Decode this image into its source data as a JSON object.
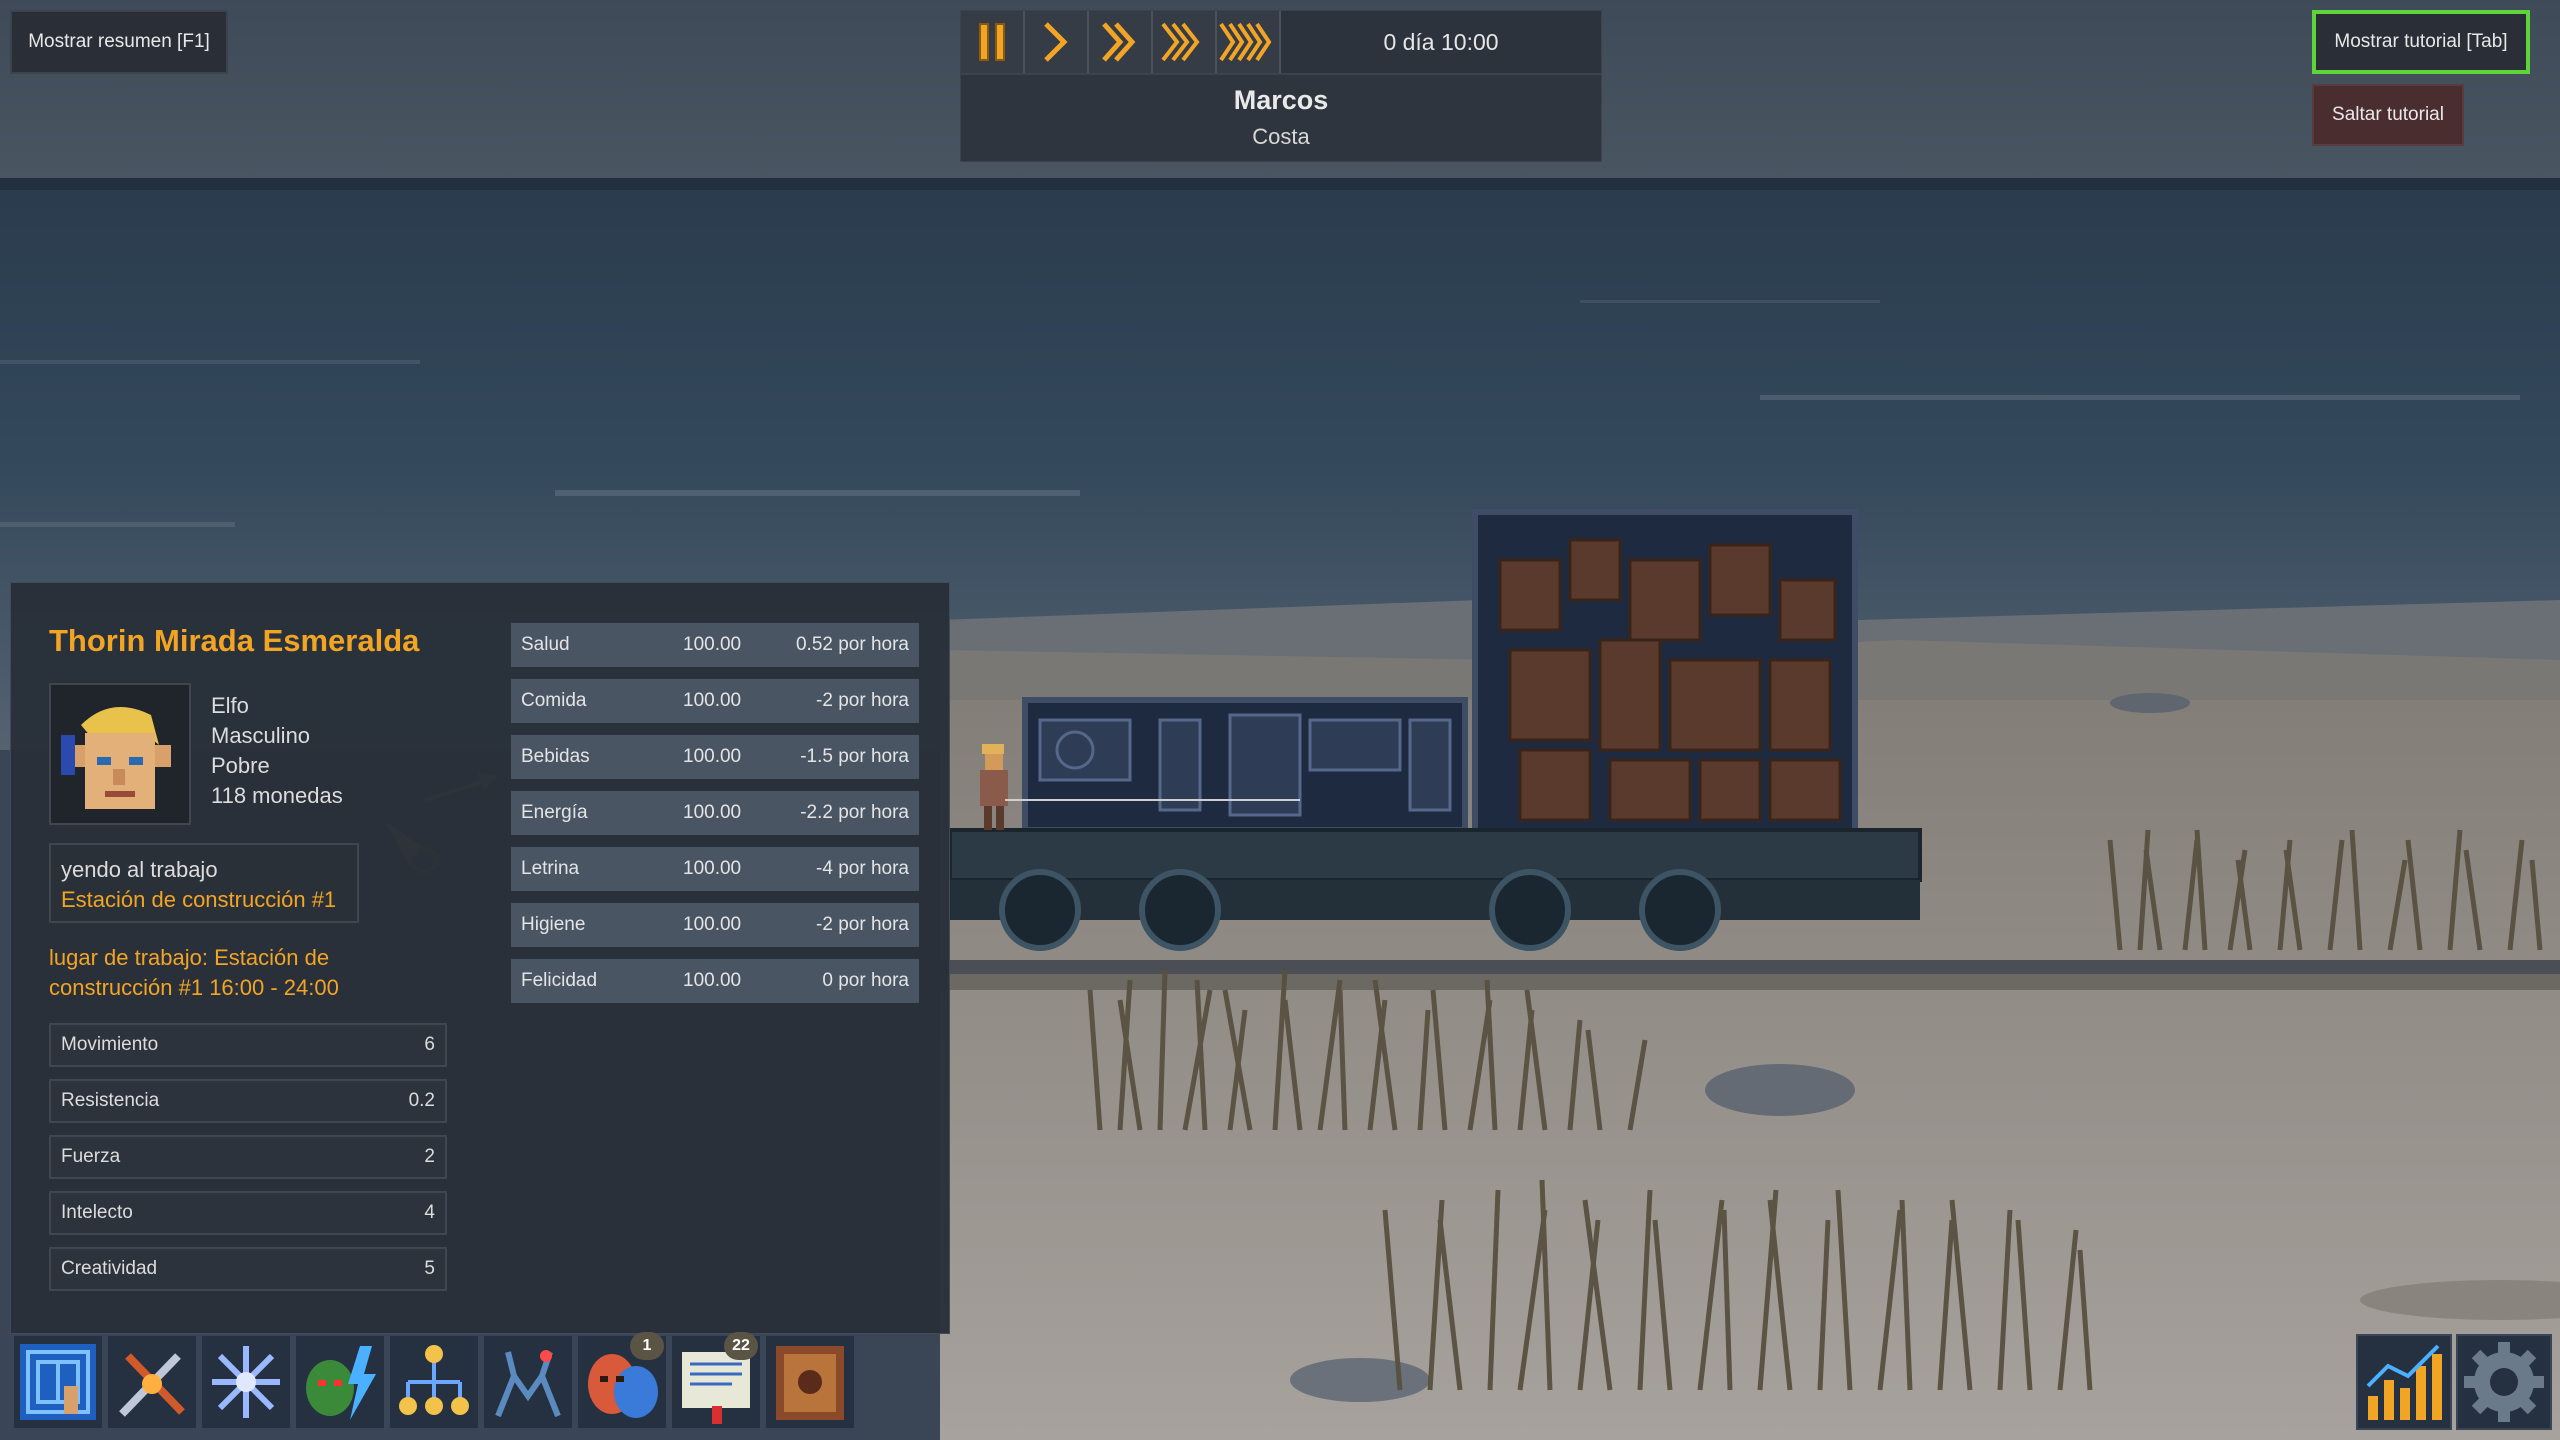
{
  "top_left": {
    "summary_button": "Mostrar resumen [F1]"
  },
  "top_right": {
    "tutorial_button": "Mostrar tutorial [Tab]",
    "skip_button": "Saltar tutorial"
  },
  "time_control": {
    "speeds": [
      "pause-icon",
      "play-icon",
      "fast-icon",
      "faster-icon",
      "fastest-icon"
    ],
    "clock": "0 día 10:00"
  },
  "location": {
    "name": "Marcos",
    "subtitle": "Costa"
  },
  "character": {
    "name": "Thorin Mirada Esmeralda",
    "race": "Elfo",
    "gender": "Masculino",
    "wealth": "Pobre",
    "coins": "118 monedas",
    "task": {
      "action": "yendo al trabajo",
      "target": "Estación de construcción #1"
    },
    "workplace": "lugar de trabajo: Estación de construcción #1 16:00 - 24:00",
    "stats": [
      {
        "label": "Movimiento",
        "value": "6"
      },
      {
        "label": "Resistencia",
        "value": "0.2"
      },
      {
        "label": "Fuerza",
        "value": "2"
      },
      {
        "label": "Intelecto",
        "value": "4"
      },
      {
        "label": "Creatividad",
        "value": "5"
      }
    ],
    "needs": [
      {
        "label": "Salud",
        "value": "100.00",
        "rate": "0.52 por hora"
      },
      {
        "label": "Comida",
        "value": "100.00",
        "rate": "-2 por hora"
      },
      {
        "label": "Bebidas",
        "value": "100.00",
        "rate": "-1.5 por hora"
      },
      {
        "label": "Energía",
        "value": "100.00",
        "rate": "-2.2 por hora"
      },
      {
        "label": "Letrina",
        "value": "100.00",
        "rate": "-4 por hora"
      },
      {
        "label": "Higiene",
        "value": "100.00",
        "rate": "-2 por hora"
      },
      {
        "label": "Felicidad",
        "value": "100.00",
        "rate": "0 por hora"
      }
    ]
  },
  "hotbar": {
    "slots": [
      {
        "icon": "blueprint-icon"
      },
      {
        "icon": "tools-icon"
      },
      {
        "icon": "snowflake-icon"
      },
      {
        "icon": "goblin-lightning-icon"
      },
      {
        "icon": "hierarchy-icon"
      },
      {
        "icon": "creature-icon"
      },
      {
        "icon": "theater-mask-icon",
        "badge": "1"
      },
      {
        "icon": "document-icon",
        "badge": "22"
      },
      {
        "icon": "leather-map-icon"
      }
    ],
    "right_slots": [
      {
        "icon": "statistics-icon"
      },
      {
        "icon": "settings-gear-icon"
      }
    ]
  },
  "colors": {
    "accent": "#f2a424",
    "tutorial_border": "#5fd33a",
    "panel": "#282f39",
    "need_row": "#4a5564"
  }
}
